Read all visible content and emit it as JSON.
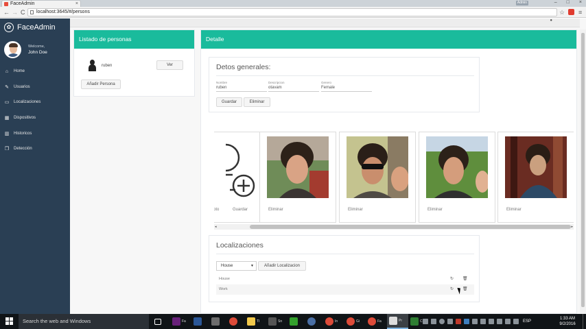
{
  "browser": {
    "tab_title": "FaceAdmin",
    "tab_close": "×",
    "profile_chip": "Admin",
    "window_controls": [
      "–",
      "□",
      "×"
    ],
    "url": "localhost:3645/#/persons",
    "nav": {
      "back": "←",
      "forward": "→",
      "reload": "C"
    },
    "star": "☆",
    "menu": "≡"
  },
  "sidebar": {
    "brand": "FaceAdmin",
    "brand_icon": "paw-icon",
    "welcome": "Welcome,",
    "user": "John Doe",
    "menu": [
      {
        "label": "Home",
        "icon": "home-icon",
        "glyph": "⌂"
      },
      {
        "label": "Usuarios",
        "icon": "edit-icon",
        "glyph": "✎"
      },
      {
        "label": "Localizaciones",
        "icon": "desktop-icon",
        "glyph": "▭"
      },
      {
        "label": "Dispositivos",
        "icon": "table-icon",
        "glyph": "▦"
      },
      {
        "label": "Historicos",
        "icon": "bar-chart-icon",
        "glyph": "▥"
      },
      {
        "label": "Detección",
        "icon": "clone-icon",
        "glyph": "❐"
      }
    ]
  },
  "left_panel": {
    "title": "Listado de personas",
    "person": {
      "name": "ruben"
    },
    "view_button": "Ver",
    "add_button": "Añadir Persona"
  },
  "detail": {
    "title": "Detalle",
    "general": {
      "title": "Detos generales:",
      "fields": [
        {
          "label": "Nombre",
          "value": "ruben"
        },
        {
          "label": "Descripcion",
          "value": "otavam"
        },
        {
          "label": "Genero",
          "value": "Female"
        }
      ],
      "save_button": "Guardar",
      "delete_button": "Eliminar"
    },
    "gallery": {
      "add_card": {
        "left_label": "oto",
        "save_label": "Guardar"
      },
      "photos": [
        {
          "delete_label": "Eliminar"
        },
        {
          "delete_label": "Eliminar"
        },
        {
          "delete_label": "Eliminar"
        },
        {
          "delete_label": "Eliminar"
        }
      ],
      "scroll_left": "◂",
      "scroll_right": "▸"
    },
    "locations": {
      "title": "Localizaciones",
      "select_value": "House",
      "add_button": "Añadir Localizacion",
      "rows": [
        {
          "name": "House",
          "refresh": "↻",
          "delete": "🗑"
        },
        {
          "name": "Work",
          "refresh": "↻",
          "delete": "🗑"
        }
      ]
    }
  },
  "taskbar": {
    "search_placeholder": "Search the web and Windows",
    "items": [
      {
        "label": "",
        "color": "#333"
      },
      {
        "label": "Fa",
        "color": "#68217a"
      },
      {
        "label": "",
        "color": "#2b5797"
      },
      {
        "label": "",
        "color": "#6d6d6d"
      },
      {
        "label": "",
        "color": "#dd4b39"
      },
      {
        "label": "TI",
        "color": "#f2c94c"
      },
      {
        "label": "Sn",
        "color": "#555"
      },
      {
        "label": "",
        "color": "#33a02c"
      },
      {
        "label": "",
        "color": "#4a6fa5"
      },
      {
        "label": "In",
        "color": "#dd4b39"
      },
      {
        "label": "Gi",
        "color": "#dd4b39"
      },
      {
        "label": "Fa",
        "color": "#dd4b39"
      },
      {
        "label": "Pr",
        "color": "#dddddd"
      },
      {
        "label": "C:",
        "color": "#2e7d32"
      }
    ],
    "language": "ESP",
    "time": "1:33 AM",
    "date": "9/2/2016"
  }
}
